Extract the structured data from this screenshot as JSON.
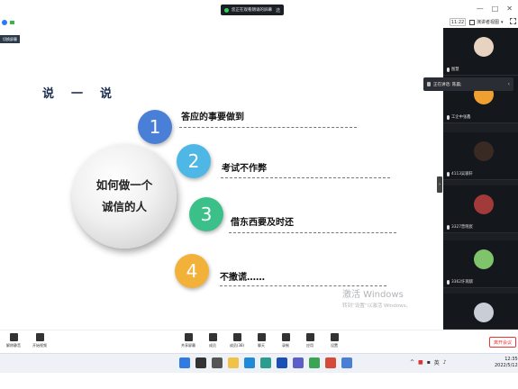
{
  "topbar": {
    "viewing_text": "您正在观看朗诵的屏幕",
    "view_option": "选",
    "time": "11:22",
    "view_label": "演讲者视图",
    "window_controls": [
      "—",
      "□",
      "✕"
    ]
  },
  "left_tag": "切换屏幕",
  "slide": {
    "title_chars": [
      "说",
      "一",
      "说"
    ],
    "center_line1": "如何做一个",
    "center_line2": "诚信的人",
    "items": [
      {
        "num": "1",
        "text": "答应的事要做到"
      },
      {
        "num": "2",
        "text": "考试不作弊"
      },
      {
        "num": "3",
        "text": "借东西要及时还"
      },
      {
        "num": "4",
        "text": "不撒谎……"
      }
    ],
    "colors": [
      "#4a7fd8",
      "#4fb7e6",
      "#3cc08a",
      "#f2b23a"
    ]
  },
  "watermark": {
    "line1": "激活 Windows",
    "line2": "转到“设置”以激活 Windows。"
  },
  "speaking": {
    "text": "正在讲话: 陈晨;"
  },
  "participants": [
    {
      "name": "图慧",
      "face_color": "#e8d2c0"
    },
    {
      "name": "工企中张鑫",
      "face_color": "#f0a030"
    },
    {
      "name": "4113吴骏轩",
      "face_color": "#3a2a24"
    },
    {
      "name": "3327曾晓宸",
      "face_color": "#a33a3a"
    },
    {
      "name": "3362许苒麒",
      "face_color": "#7fc36a"
    },
    {
      "name": "",
      "face_color": "#c9ced6"
    }
  ],
  "toolbar": {
    "left": [
      {
        "label": "解除静音",
        "icon": "mic-icon"
      },
      {
        "label": "开始视频",
        "icon": "camera-off-icon"
      }
    ],
    "center": [
      {
        "label": "共享屏幕",
        "icon": "share-screen-icon"
      },
      {
        "label": "成员",
        "icon": "members-icon"
      },
      {
        "label": "成员(38)",
        "icon": "users-icon"
      },
      {
        "label": "聊天",
        "icon": "chat-icon"
      },
      {
        "label": "录制",
        "icon": "record-icon"
      },
      {
        "label": "应用",
        "icon": "apps-icon"
      },
      {
        "label": "设置",
        "icon": "settings-icon"
      }
    ],
    "end_label": "离开会议"
  },
  "taskbar": {
    "tray_text": "英",
    "time": "12:35",
    "date": "2022/5/12"
  }
}
